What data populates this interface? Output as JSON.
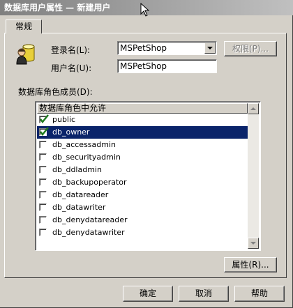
{
  "window": {
    "title": "数据库用户属性 — 新建用户"
  },
  "tabs": [
    {
      "label": "常规"
    }
  ],
  "login": {
    "label": "登录名(L):",
    "value": "MSPetShop",
    "permissions_button": "权限(P)..."
  },
  "username": {
    "label": "用户名(U):",
    "value": "MSPetShop"
  },
  "roles": {
    "label": "数据库角色成员(D):",
    "column_header": "数据库角色中允许",
    "items": [
      {
        "label": "public",
        "checked": true
      },
      {
        "label": "db_owner",
        "checked": true
      },
      {
        "label": "db_accessadmin",
        "checked": false
      },
      {
        "label": "db_securityadmin",
        "checked": false
      },
      {
        "label": "db_ddladmin",
        "checked": false
      },
      {
        "label": "db_backupoperator",
        "checked": false
      },
      {
        "label": "db_datareader",
        "checked": false
      },
      {
        "label": "db_datawriter",
        "checked": false
      },
      {
        "label": "db_denydatareader",
        "checked": false
      },
      {
        "label": "db_denydatawriter",
        "checked": false
      }
    ],
    "selected_index": 1,
    "properties_button": "属性(R)..."
  },
  "footer": {
    "ok": "确定",
    "cancel": "取消",
    "help": "帮助"
  },
  "colors": {
    "selection": "#0a246a",
    "check": "#1f7a1f",
    "face": "#d4d0c8"
  }
}
